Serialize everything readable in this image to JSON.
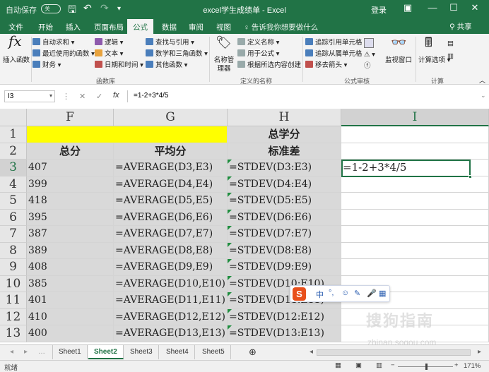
{
  "titlebar": {
    "autosave": "自动保存",
    "toggle": "关",
    "title": "excel学生成绩单 - Excel",
    "signin": "登录"
  },
  "tabs": [
    "文件",
    "开始",
    "插入",
    "页面布局",
    "公式",
    "数据",
    "审阅",
    "视图"
  ],
  "active_tab": "公式",
  "tell_me": "♀ 告诉我你想要做什么",
  "share": "共享",
  "ribbon": {
    "insert_fn": "插入函数",
    "lib": [
      "自动求和",
      "最近使用的函数",
      "财务",
      "逻辑",
      "文本",
      "日期和时间",
      "查找与引用",
      "数学和三角函数",
      "其他函数"
    ],
    "lib_group": "函数库",
    "name_mgr": "名称管理器",
    "names": [
      "定义名称",
      "用于公式",
      "根据所选内容创建"
    ],
    "names_group": "定义的名称",
    "audit": [
      "追踪引用单元格",
      "追踪从属单元格",
      "移去箭头"
    ],
    "watch": "监视窗口",
    "audit_group": "公式审核",
    "calc_opts": "计算选项",
    "calc_group": "计算"
  },
  "formula_bar": {
    "namebox": "I3",
    "fx": "fx",
    "formula": "=1-2+3*4/5"
  },
  "columns": [
    "F",
    "G",
    "H",
    "I"
  ],
  "rows": [
    {
      "n": "1",
      "F": "",
      "G": "",
      "H": "总学分",
      "I": ""
    },
    {
      "n": "2",
      "F": "总分",
      "G": "平均分",
      "H": "标准差",
      "I": ""
    },
    {
      "n": "3",
      "F": "407",
      "G": "=AVERAGE(D3,E3)",
      "H": "=STDEV(D3:E3)",
      "I": "=1-2+3*4/5"
    },
    {
      "n": "4",
      "F": "399",
      "G": "=AVERAGE(D4,E4)",
      "H": "=STDEV(D4:E4)",
      "I": ""
    },
    {
      "n": "5",
      "F": "418",
      "G": "=AVERAGE(D5,E5)",
      "H": "=STDEV(D5:E5)",
      "I": ""
    },
    {
      "n": "6",
      "F": "395",
      "G": "=AVERAGE(D6,E6)",
      "H": "=STDEV(D6:E6)",
      "I": ""
    },
    {
      "n": "7",
      "F": "387",
      "G": "=AVERAGE(D7,E7)",
      "H": "=STDEV(D7:E7)",
      "I": ""
    },
    {
      "n": "8",
      "F": "389",
      "G": "=AVERAGE(D8,E8)",
      "H": "=STDEV(D8:E8)",
      "I": ""
    },
    {
      "n": "9",
      "F": "408",
      "G": "=AVERAGE(D9,E9)",
      "H": "=STDEV(D9:E9)",
      "I": ""
    },
    {
      "n": "10",
      "F": "385",
      "G": "=AVERAGE(D10,E10)",
      "H": "=STDEV(D10:E10)",
      "I": ""
    },
    {
      "n": "11",
      "F": "401",
      "G": "=AVERAGE(D11,E11)",
      "H": "=STDEV(D11:E11)",
      "I": ""
    },
    {
      "n": "12",
      "F": "410",
      "G": "=AVERAGE(D12,E12)",
      "H": "=STDEV(D12:E12)",
      "I": ""
    },
    {
      "n": "13",
      "F": "400",
      "G": "=AVERAGE(D13,E13)",
      "H": "=STDEV(D13:E13)",
      "I": ""
    }
  ],
  "sheets": [
    "Sheet1",
    "Sheet2",
    "Sheet3",
    "Sheet4",
    "Sheet5"
  ],
  "active_sheet": "Sheet2",
  "status": {
    "ready": "就绪",
    "zoom": "171%"
  },
  "ime": {
    "logo": "S",
    "mode": "中"
  },
  "watermark": {
    "main": "搜狗指南",
    "sub": "zhinan.sogou.com"
  },
  "colors": {
    "accent": "#217346",
    "highlight": "#ffff00",
    "header_fill": "#d9d9d9"
  }
}
